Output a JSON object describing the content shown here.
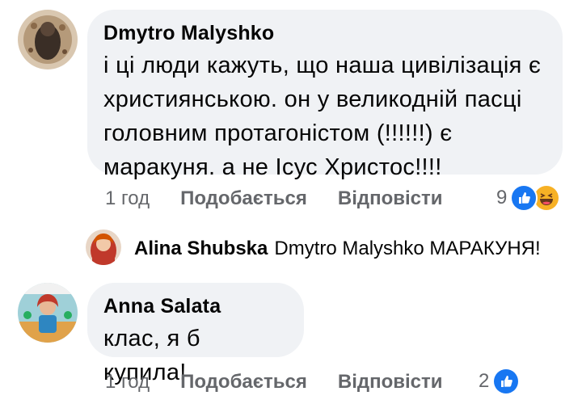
{
  "comments": [
    {
      "author": "Dmytro  Malyshko",
      "lines": [
        "і ці люди кажуть, що наша цивілізація є",
        "християнською. он у великодній пасці",
        "головним протагоністом (!!!!!!) є",
        "маракуня. а не Ісус Христос!!!!"
      ],
      "time": "1 год",
      "like_label": "Подобається",
      "reply_label": "Відповісти",
      "reaction_count": "9",
      "reaction_icons": [
        "like-icon",
        "haha-icon"
      ]
    },
    {
      "author": "Anna Salata",
      "lines": [
        "клас, я б купила!"
      ],
      "time": "1 год",
      "like_label": "Подобається",
      "reply_label": "Відповісти",
      "reaction_count": "2",
      "reaction_icons": [
        "like-icon"
      ]
    }
  ],
  "reply": {
    "author": "Alina Shubska",
    "text": "Dmytro  Malyshko МАРАКУНЯ!"
  },
  "colors": {
    "bubble": "#f0f2f5",
    "secondary_text": "#65676b",
    "like_blue": "#1877f2",
    "haha_yellow": "#f7b125"
  }
}
